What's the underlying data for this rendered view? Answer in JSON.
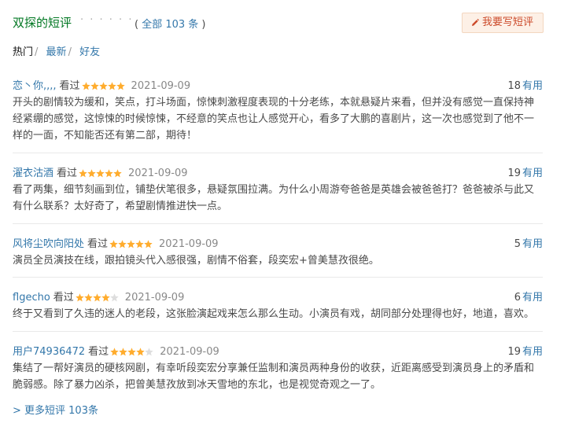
{
  "header": {
    "title": "双探的短评",
    "dots": "· · · · · ·",
    "count_prefix": "( ",
    "count_link": "全部 103 条",
    "count_suffix": " )",
    "write_button": "我要写短评"
  },
  "tabs": [
    {
      "label": "热门",
      "active": true
    },
    {
      "label": "最新",
      "active": false
    },
    {
      "label": "好友",
      "active": false
    }
  ],
  "colors": {
    "star_on": "#ffac2d",
    "star_off": "#dddddd",
    "link": "#3377aa",
    "title": "#007722",
    "button_text": "#cc4a2a"
  },
  "comments": [
    {
      "user": "恋丶你,,,,",
      "status": "看过",
      "rating": 5,
      "date": "2021-09-09",
      "votes": "18",
      "votes_label": "有用",
      "text": "开头的剧情较为缓和，笑点，打斗场面，惊悚刺激程度表现的十分老练，本就悬疑片来看，但并没有感觉一直保持神经紧绷的感觉，这惊悚的时候惊悚，不经意的笑点也让人感觉开心，看多了大鹏的喜剧片，这一次也感觉到了他不一样的一面，不知能否还有第二部，期待！"
    },
    {
      "user": "濯衣沽酒",
      "status": "看过",
      "rating": 5,
      "date": "2021-09-09",
      "votes": "19",
      "votes_label": "有用",
      "text": "看了两集，细节刻画到位，铺垫伏笔很多，悬疑氛围拉满。为什么小周游夸爸爸是英雄会被爸爸打？爸爸被杀与此又有什么联系？太好奇了，希望剧情推进快一点。"
    },
    {
      "user": "风将尘吹向阳处",
      "status": "看过",
      "rating": 5,
      "date": "2021-09-09",
      "votes": "5",
      "votes_label": "有用",
      "text": "演员全员演技在线，跟拍镜头代入感很强，剧情不俗套，段奕宏+曾美慧孜很绝。"
    },
    {
      "user": "flgecho",
      "status": "看过",
      "rating": 4,
      "date": "2021-09-09",
      "votes": "6",
      "votes_label": "有用",
      "text": "终于又看到了久违的迷人的老段，这张脸演起戏来怎么那么生动。小演员有戏，胡同部分处理得也好，地道，喜欢。"
    },
    {
      "user": "用户74936472",
      "status": "看过",
      "rating": 4,
      "date": "2021-09-09",
      "votes": "19",
      "votes_label": "有用",
      "text": "集结了一帮好演员的硬核网剧，有幸听段奕宏分享兼任监制和演员两种身份的收获，近距离感受到演员身上的矛盾和脆弱感。除了暴力凶杀，把曾美慧孜放到冰天雪地的东北，也是视觉奇观之一了。"
    }
  ],
  "more_link": "> 更多短评 103条"
}
